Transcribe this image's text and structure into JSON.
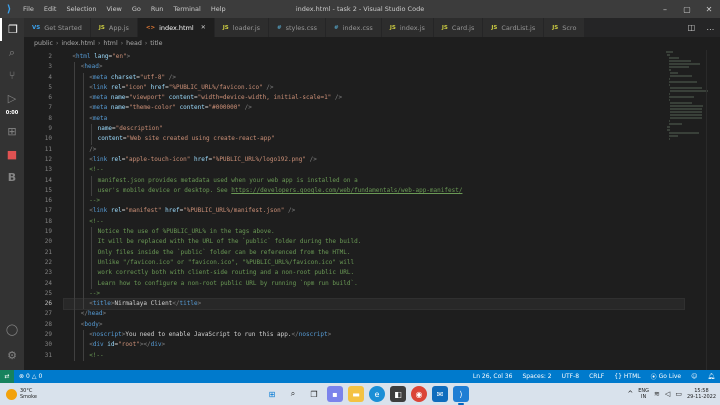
{
  "titlebar": {
    "menus": [
      "File",
      "Edit",
      "Selection",
      "View",
      "Go",
      "Run",
      "Terminal",
      "Help"
    ],
    "title": "index.html - task 2 - Visual Studio Code"
  },
  "tabs": [
    {
      "icon": "VS",
      "label": "Get Started",
      "color": "#3ba3f0",
      "active": false
    },
    {
      "icon": "JS",
      "label": "App.js",
      "color": "#cbcb41",
      "active": false
    },
    {
      "icon": "<>",
      "label": "index.html",
      "color": "#e37933",
      "active": true
    },
    {
      "icon": "JS",
      "label": "loader.js",
      "color": "#cbcb41",
      "active": false
    },
    {
      "icon": "#",
      "label": "styles.css",
      "color": "#519aba",
      "active": false
    },
    {
      "icon": "#",
      "label": "index.css",
      "color": "#519aba",
      "active": false
    },
    {
      "icon": "JS",
      "label": "index.js",
      "color": "#cbcb41",
      "active": false
    },
    {
      "icon": "JS",
      "label": "Card.js",
      "color": "#cbcb41",
      "active": false
    },
    {
      "icon": "JS",
      "label": "CardList.js",
      "color": "#cbcb41",
      "active": false
    },
    {
      "icon": "JS",
      "label": "Scro",
      "color": "#cbcb41",
      "active": false
    }
  ],
  "activity": {
    "timer": "0:00",
    "icons": [
      "files-icon",
      "search-icon",
      "source-control-icon",
      "run-debug-icon",
      "extensions-icon",
      "remote-icon",
      "stop-icon",
      "b-icon"
    ]
  },
  "breadcrumb": [
    "public",
    "index.html",
    "html",
    "head",
    "title"
  ],
  "editor": {
    "current_line": 26,
    "lines": [
      {
        "n": 2,
        "indent": 1,
        "segs": [
          [
            "br",
            "<"
          ],
          [
            "tag",
            "html"
          ],
          [
            "txt",
            " "
          ],
          [
            "attr",
            "lang"
          ],
          [
            "txt",
            "="
          ],
          [
            "str",
            "\"en\""
          ],
          [
            "br",
            ">"
          ]
        ]
      },
      {
        "n": 3,
        "indent": 2,
        "segs": [
          [
            "br",
            "<"
          ],
          [
            "tag",
            "head"
          ],
          [
            "br",
            ">"
          ]
        ]
      },
      {
        "n": 4,
        "indent": 3,
        "segs": [
          [
            "br",
            "<"
          ],
          [
            "tag",
            "meta"
          ],
          [
            "txt",
            " "
          ],
          [
            "attr",
            "charset"
          ],
          [
            "txt",
            "="
          ],
          [
            "str",
            "\"utf-8\""
          ],
          [
            "txt",
            " "
          ],
          [
            "br",
            "/>"
          ]
        ]
      },
      {
        "n": 5,
        "indent": 3,
        "segs": [
          [
            "br",
            "<"
          ],
          [
            "tag",
            "link"
          ],
          [
            "txt",
            " "
          ],
          [
            "attr",
            "rel"
          ],
          [
            "txt",
            "="
          ],
          [
            "str",
            "\"icon\""
          ],
          [
            "txt",
            " "
          ],
          [
            "attr",
            "href"
          ],
          [
            "txt",
            "="
          ],
          [
            "str",
            "\"%PUBLIC_URL%/favicon.ico\""
          ],
          [
            "txt",
            " "
          ],
          [
            "br",
            "/>"
          ]
        ]
      },
      {
        "n": 6,
        "indent": 3,
        "segs": [
          [
            "br",
            "<"
          ],
          [
            "tag",
            "meta"
          ],
          [
            "txt",
            " "
          ],
          [
            "attr",
            "name"
          ],
          [
            "txt",
            "="
          ],
          [
            "str",
            "\"viewport\""
          ],
          [
            "txt",
            " "
          ],
          [
            "attr",
            "content"
          ],
          [
            "txt",
            "="
          ],
          [
            "str",
            "\"width=device-width, initial-scale=1\""
          ],
          [
            "txt",
            " "
          ],
          [
            "br",
            "/>"
          ]
        ]
      },
      {
        "n": 7,
        "indent": 3,
        "segs": [
          [
            "br",
            "<"
          ],
          [
            "tag",
            "meta"
          ],
          [
            "txt",
            " "
          ],
          [
            "attr",
            "name"
          ],
          [
            "txt",
            "="
          ],
          [
            "str",
            "\"theme-color\""
          ],
          [
            "txt",
            " "
          ],
          [
            "attr",
            "content"
          ],
          [
            "txt",
            "="
          ],
          [
            "str",
            "\"#000000\""
          ],
          [
            "txt",
            " "
          ],
          [
            "br",
            "/>"
          ]
        ]
      },
      {
        "n": 8,
        "indent": 3,
        "segs": [
          [
            "br",
            "<"
          ],
          [
            "tag",
            "meta"
          ]
        ]
      },
      {
        "n": 9,
        "indent": 4,
        "segs": [
          [
            "attr",
            "name"
          ],
          [
            "txt",
            "="
          ],
          [
            "str",
            "\"description\""
          ]
        ]
      },
      {
        "n": 10,
        "indent": 4,
        "segs": [
          [
            "attr",
            "content"
          ],
          [
            "txt",
            "="
          ],
          [
            "str",
            "\"Web site created using create-react-app\""
          ]
        ]
      },
      {
        "n": 11,
        "indent": 3,
        "segs": [
          [
            "br",
            "/>"
          ]
        ]
      },
      {
        "n": 12,
        "indent": 3,
        "segs": [
          [
            "br",
            "<"
          ],
          [
            "tag",
            "link"
          ],
          [
            "txt",
            " "
          ],
          [
            "attr",
            "rel"
          ],
          [
            "txt",
            "="
          ],
          [
            "str",
            "\"apple-touch-icon\""
          ],
          [
            "txt",
            " "
          ],
          [
            "attr",
            "href"
          ],
          [
            "txt",
            "="
          ],
          [
            "str",
            "\"%PUBLIC_URL%/logo192.png\""
          ],
          [
            "txt",
            " "
          ],
          [
            "br",
            "/>"
          ]
        ]
      },
      {
        "n": 13,
        "indent": 3,
        "segs": [
          [
            "com",
            "<!--"
          ]
        ]
      },
      {
        "n": 14,
        "indent": 4,
        "segs": [
          [
            "com",
            "manifest.json provides metadata used when your web app is installed on a"
          ]
        ]
      },
      {
        "n": 15,
        "indent": 4,
        "segs": [
          [
            "com",
            "user's mobile device or desktop. See "
          ],
          [
            "link",
            "https://developers.google.com/web/fundamentals/web-app-manifest/"
          ]
        ]
      },
      {
        "n": 16,
        "indent": 3,
        "segs": [
          [
            "com",
            "-->"
          ]
        ]
      },
      {
        "n": 17,
        "indent": 3,
        "segs": [
          [
            "br",
            "<"
          ],
          [
            "tag",
            "link"
          ],
          [
            "txt",
            " "
          ],
          [
            "attr",
            "rel"
          ],
          [
            "txt",
            "="
          ],
          [
            "str",
            "\"manifest\""
          ],
          [
            "txt",
            " "
          ],
          [
            "attr",
            "href"
          ],
          [
            "txt",
            "="
          ],
          [
            "str",
            "\"%PUBLIC_URL%/manifest.json\""
          ],
          [
            "txt",
            " "
          ],
          [
            "br",
            "/>"
          ]
        ]
      },
      {
        "n": 18,
        "indent": 3,
        "segs": [
          [
            "com",
            "<!--"
          ]
        ]
      },
      {
        "n": 19,
        "indent": 4,
        "segs": [
          [
            "com",
            "Notice the use of %PUBLIC_URL% in the tags above."
          ]
        ]
      },
      {
        "n": 20,
        "indent": 4,
        "segs": [
          [
            "com",
            "It will be replaced with the URL of the `public` folder during the build."
          ]
        ]
      },
      {
        "n": 21,
        "indent": 4,
        "segs": [
          [
            "com",
            "Only files inside the `public` folder can be referenced from the HTML."
          ]
        ]
      },
      {
        "n": 22,
        "indent": 4,
        "segs": [
          [
            "com",
            "Unlike \"/favicon.ico\" or \"favicon.ico\", \"%PUBLIC_URL%/favicon.ico\" will"
          ]
        ]
      },
      {
        "n": 23,
        "indent": 4,
        "segs": [
          [
            "com",
            "work correctly both with client-side routing and a non-root public URL."
          ]
        ]
      },
      {
        "n": 24,
        "indent": 4,
        "segs": [
          [
            "com",
            "Learn how to configure a non-root public URL by running `npm run build`."
          ]
        ]
      },
      {
        "n": 25,
        "indent": 3,
        "segs": [
          [
            "com",
            "-->"
          ]
        ]
      },
      {
        "n": 26,
        "indent": 3,
        "segs": [
          [
            "br",
            "<"
          ],
          [
            "tag",
            "title"
          ],
          [
            "br",
            ">"
          ],
          [
            "txt",
            "Nirmalaya Client"
          ],
          [
            "br",
            "</"
          ],
          [
            "tag",
            "title"
          ],
          [
            "br",
            ">"
          ]
        ]
      },
      {
        "n": 27,
        "indent": 2,
        "segs": [
          [
            "br",
            "</"
          ],
          [
            "tag",
            "head"
          ],
          [
            "br",
            ">"
          ]
        ]
      },
      {
        "n": 28,
        "indent": 2,
        "segs": [
          [
            "br",
            "<"
          ],
          [
            "tag",
            "body"
          ],
          [
            "br",
            ">"
          ]
        ]
      },
      {
        "n": 29,
        "indent": 3,
        "segs": [
          [
            "br",
            "<"
          ],
          [
            "tag",
            "noscript"
          ],
          [
            "br",
            ">"
          ],
          [
            "txt",
            "You need to enable JavaScript to run this app."
          ],
          [
            "br",
            "</"
          ],
          [
            "tag",
            "noscript"
          ],
          [
            "br",
            ">"
          ]
        ]
      },
      {
        "n": 30,
        "indent": 3,
        "segs": [
          [
            "br",
            "<"
          ],
          [
            "tag",
            "div"
          ],
          [
            "txt",
            " "
          ],
          [
            "attr",
            "id"
          ],
          [
            "txt",
            "="
          ],
          [
            "str",
            "\"root\""
          ],
          [
            "br",
            "></"
          ],
          [
            "tag",
            "div"
          ],
          [
            "br",
            ">"
          ]
        ]
      },
      {
        "n": 31,
        "indent": 3,
        "segs": [
          [
            "com",
            "<!--"
          ]
        ]
      }
    ]
  },
  "statusbar": {
    "errors": "0",
    "warnings": "0",
    "position": "Ln 26, Col 36",
    "spaces": "Spaces: 2",
    "encoding": "UTF-8",
    "eol": "CRLF",
    "language": "HTML",
    "golive": "Go Live"
  },
  "taskbar": {
    "temp": "30°C",
    "weather": "Smoke",
    "lang_top": "ENG",
    "lang_bottom": "IN",
    "time": "15:58",
    "date": "29-11-2022"
  }
}
